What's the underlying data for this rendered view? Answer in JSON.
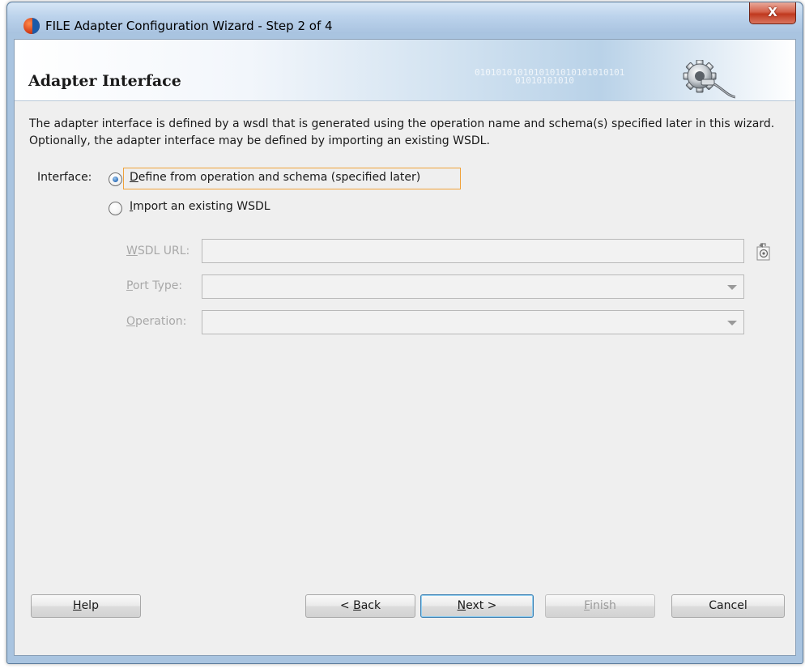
{
  "window": {
    "title": "FILE Adapter Configuration Wizard - Step 2 of 4",
    "close_label": "X"
  },
  "banner": {
    "title": "Adapter Interface",
    "binary_line1": "0101010101010101010101010101",
    "binary_line2": "01010101010"
  },
  "description": "The adapter interface is defined by a wsdl that is generated using the operation name and schema(s) specified later in this wizard.  Optionally, the adapter interface may be defined by importing an existing WSDL.",
  "interface": {
    "label": "Interface:",
    "options": [
      {
        "label": "Define from operation and schema (specified later)",
        "mnemonic": "D",
        "rest": "efine from operation and schema (specified later)",
        "selected": true
      },
      {
        "label": "Import an existing WSDL",
        "mnemonic": "I",
        "rest": "mport an existing WSDL",
        "selected": false
      }
    ]
  },
  "fields": {
    "wsdl_url": {
      "label": "WSDL URL:",
      "mnemonic": "W",
      "rest": "SDL URL:",
      "value": ""
    },
    "port_type": {
      "label": "Port Type:",
      "mnemonic": "P",
      "rest": "ort Type:",
      "value": ""
    },
    "operation": {
      "label": "Operation:",
      "mnemonic": "O",
      "rest": "peration:",
      "value": ""
    }
  },
  "buttons": {
    "help": {
      "pre": "",
      "mnemonic": "H",
      "rest": "elp"
    },
    "back": {
      "pre": "< ",
      "mnemonic": "B",
      "rest": "ack"
    },
    "next": {
      "pre": "",
      "mnemonic": "N",
      "rest": "ext >"
    },
    "finish": {
      "pre": "",
      "mnemonic": "F",
      "rest": "inish"
    },
    "cancel": {
      "pre": "",
      "mnemonic": "",
      "rest": "Cancel"
    }
  },
  "icons": {
    "app": "oracle-jdeveloper-icon",
    "banner": "gear-adapter-icon",
    "browse": "browse-wsdl-icon"
  },
  "colors": {
    "focus_outline": "#f0a23a",
    "default_button_border": "#3c7fb1",
    "disabled_text": "#a8a8a8"
  }
}
